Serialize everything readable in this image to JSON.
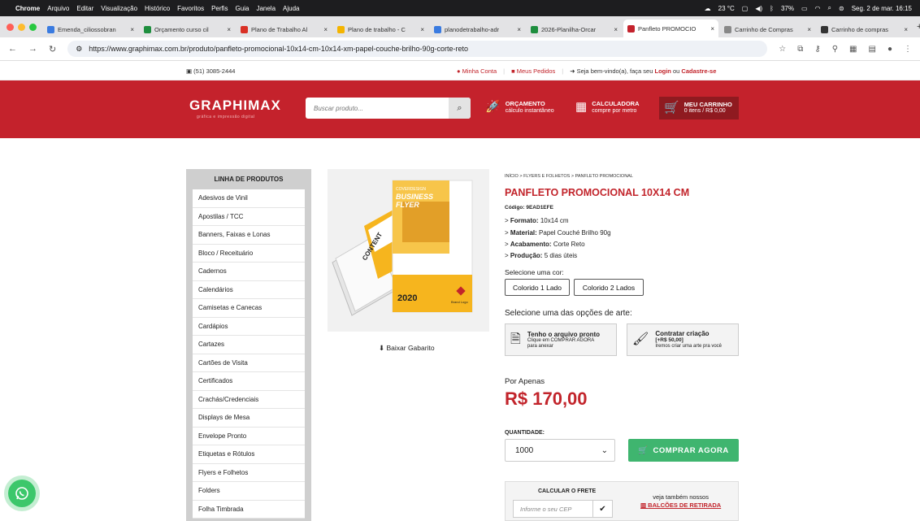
{
  "macos": {
    "apple": "",
    "app": "Chrome",
    "menus": [
      "Arquivo",
      "Editar",
      "Visualização",
      "Histórico",
      "Favoritos",
      "Perfis",
      "Guia",
      "Janela",
      "Ajuda"
    ],
    "temp": "23 °C",
    "battery": "37%",
    "datetime": "Seg. 2 de mar.  16:15"
  },
  "tabs": [
    {
      "title": "Emenda_ciliossobran",
      "color": "#3a7be0",
      "active": false
    },
    {
      "title": "Orçamento curso cil",
      "color": "#1e8e3e",
      "active": false
    },
    {
      "title": "Plano de Trabalho Al",
      "color": "#d93025",
      "active": false
    },
    {
      "title": "Plano de trabalho - C",
      "color": "#f4b400",
      "active": false
    },
    {
      "title": "planodetrabalho-adr",
      "color": "#3a7be0",
      "active": false
    },
    {
      "title": "2026-Planilha-Orcar",
      "color": "#1e8e3e",
      "active": false
    },
    {
      "title": "Panfleto PROMOCIO",
      "color": "#c4222c",
      "active": true
    },
    {
      "title": "Carrinho de Compras",
      "color": "#888888",
      "active": false
    },
    {
      "title": "Carrinho de compras",
      "color": "#333333",
      "active": false
    }
  ],
  "browser": {
    "url": "https://www.graphimax.com.br/produto/panfleto-promocional-10x14-cm-10x14-xm-papel-couche-brilho-90g-corte-reto",
    "new_tab": "+"
  },
  "topstrip": {
    "phone": "(51) 3085-2444",
    "my_account": "Minha Conta",
    "my_orders": "Meus Pedidos",
    "welcome_prefix": "Seja bem-vindo(a), faça seu ",
    "login": "Login",
    "or": " ou ",
    "register": "Cadastre-se"
  },
  "header": {
    "logo": "GRAPHIMAX",
    "logo_sub": "gráfica e impressão digital",
    "search_placeholder": "Buscar produto...",
    "orcamento_title": "ORÇAMENTO",
    "orcamento_sub": "cálculo instantâneo",
    "calc_title": "CALCULADORA",
    "calc_sub": "compre por metro",
    "cart_title": "MEU CARRINHO",
    "cart_sub": "0 itens / R$ 0,00"
  },
  "sidebar": {
    "title": "LINHA DE PRODUTOS",
    "items": [
      "Adesivos de Vinil",
      "Apostilas / TCC",
      "Banners, Faixas e Lonas",
      "Bloco / Receituário",
      "Cadernos",
      "Calendários",
      "Camisetas e Canecas",
      "Cardápios",
      "Cartazes",
      "Cartões de Visita",
      "Certificados",
      "Crachás/Credenciais",
      "Displays de Mesa",
      "Envelope Pronto",
      "Etiquetas e Rótulos",
      "Flyers e Folhetos",
      "Folders",
      "Folha Timbrada"
    ]
  },
  "product": {
    "image_texts": {
      "cover": "COVERDESIGN",
      "business": "BUSINESS",
      "flyer": "FLYER",
      "content": "CONTENT",
      "year": "2020",
      "brand": "Brand Logo"
    },
    "download": "Baixar Gabarito",
    "breadcrumb": "INÍCIO > FLYERS E FOLHETOS > PANFLETO PROMOCIONAL",
    "title": "PANFLETO PROMOCIONAL 10X14 CM",
    "code": "Código: 9EAD1EFE",
    "specs": [
      {
        "label": "Formato:",
        "value": "10x14 cm"
      },
      {
        "label": "Material:",
        "value": "Papel Couché Brilho 90g"
      },
      {
        "label": "Acabamento:",
        "value": "Corte Reto"
      },
      {
        "label": "Produção:",
        "value": "5 dias úteis"
      }
    ],
    "color_label": "Selecione uma cor:",
    "color_options": [
      "Colorido 1 Lado",
      "Colorido 2 Lados"
    ],
    "art_label": "Selecione uma das opções de arte:",
    "art_own_title": "Tenho o arquivo pronto",
    "art_own_sub1": "Clique em COMPRAR AGORA",
    "art_own_sub2": "para anexar",
    "art_hire_title": "Contratar criação",
    "art_hire_price": "[+R$ 50,00]",
    "art_hire_sub": "Iremos criar uma arte pra você",
    "price_prefix": "Por Apenas",
    "price": "R$ 170,00",
    "qty_label": "QUANTIDADE:",
    "qty_value": "1000",
    "buy": "COMPRAR AGORA",
    "freight_title": "CALCULAR O FRETE",
    "cep_placeholder": "Informe o seu CEP",
    "also_see": "veja também nossos",
    "pickup": "BALCÕES DE RETIRADA"
  },
  "colors": {
    "brand_red": "#c4222c",
    "buy_green": "#3fb56f",
    "whatsapp": "#3cc76b"
  }
}
